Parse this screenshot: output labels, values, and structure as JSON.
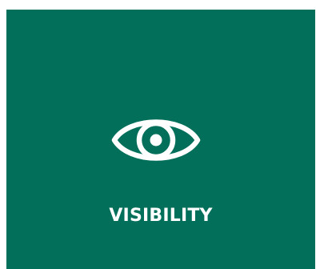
{
  "card": {
    "label": "VISIBILITY",
    "icon": "eye-icon",
    "background_color": "#026F5B",
    "foreground_color": "#FFFFFF"
  }
}
